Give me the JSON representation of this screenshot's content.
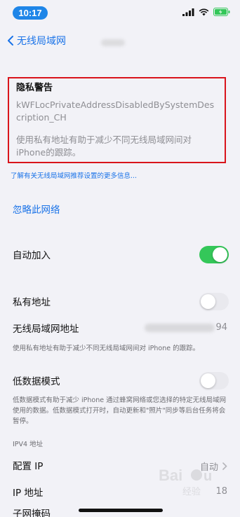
{
  "status": {
    "time": "10:17"
  },
  "nav": {
    "back_label": "无线局域网"
  },
  "warning": {
    "title": "隐私警告",
    "code": "kWFLocPrivateAddressDisabledBySystemDescription_CH",
    "description": "使用私有地址有助于减少不同无线局域网间对iPhone的跟踪。"
  },
  "learn_more_link": "了解有关无线局域网推荐设置的更多信息...",
  "forget_network": "忽略此网络",
  "auto_join": {
    "label": "自动加入",
    "on": true
  },
  "private_address": {
    "label": "私有地址",
    "on": false
  },
  "wifi_address": {
    "label": "无线局域网地址",
    "value_suffix": "94"
  },
  "private_note": "使用私有地址有助于减少不同无线局域网间对 iPhone 的跟踪。",
  "low_data": {
    "label": "低数据模式",
    "on": false,
    "note": "低数据模式有助于减少 iPhone 通过蜂窝网络或您选择的特定无线局域网使用的数据。低数据模式打开时，自动更新和\"照片\"同步等后台任务将会暂停。"
  },
  "ipv4": {
    "header": "IPV4 地址",
    "configure_ip": {
      "label": "配置 IP",
      "value": "自动"
    },
    "ip_address": {
      "label": "IP 地址",
      "value_suffix": "18"
    },
    "subnet": {
      "label": "子网掩码"
    }
  },
  "watermark": "Baidu 经验"
}
